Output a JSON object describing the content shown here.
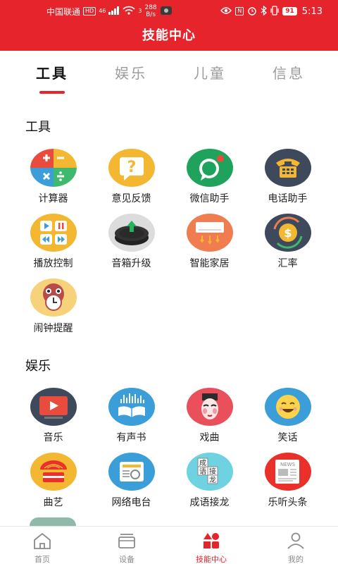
{
  "status_bar": {
    "carrier": "中国联通",
    "hd": "HD",
    "signal": "46",
    "wifi_sub": "3",
    "speed_value": "288",
    "speed_unit": "B/s",
    "nfc": "N",
    "battery": "91",
    "time": "5:13"
  },
  "header": {
    "title": "技能中心"
  },
  "tabs": [
    {
      "label": "工具",
      "active": true
    },
    {
      "label": "娱乐",
      "active": false
    },
    {
      "label": "儿童",
      "active": false
    },
    {
      "label": "信息",
      "active": false
    }
  ],
  "sections": [
    {
      "title": "工具",
      "items": [
        {
          "label": "计算器",
          "icon": "calculator-icon"
        },
        {
          "label": "意见反馈",
          "icon": "question-icon"
        },
        {
          "label": "微信助手",
          "icon": "chat-bubble-icon"
        },
        {
          "label": "电话助手",
          "icon": "telephone-icon"
        },
        {
          "label": "播放控制",
          "icon": "media-controls-icon"
        },
        {
          "label": "音箱升级",
          "icon": "speaker-upgrade-icon"
        },
        {
          "label": "智能家居",
          "icon": "air-conditioner-icon"
        },
        {
          "label": "汇率",
          "icon": "currency-exchange-icon"
        },
        {
          "label": "闹钟提醒",
          "icon": "alarm-clock-icon"
        }
      ]
    },
    {
      "title": "娱乐",
      "items": [
        {
          "label": "音乐",
          "icon": "music-video-icon"
        },
        {
          "label": "有声书",
          "icon": "audiobook-icon"
        },
        {
          "label": "戏曲",
          "icon": "opera-mask-icon"
        },
        {
          "label": "笑话",
          "icon": "smiley-icon"
        },
        {
          "label": "曲艺",
          "icon": "drum-icon"
        },
        {
          "label": "网络电台",
          "icon": "radio-icon"
        },
        {
          "label": "成语接龙",
          "icon": "idiom-puzzle-icon",
          "chars": [
            "成",
            "语",
            "接",
            "龙"
          ]
        },
        {
          "label": "乐听头条",
          "icon": "newspaper-icon",
          "news": "NEWS"
        }
      ]
    }
  ],
  "bottom_nav": [
    {
      "label": "首页",
      "icon": "home-icon",
      "active": false
    },
    {
      "label": "设备",
      "icon": "device-icon",
      "active": false
    },
    {
      "label": "技能中心",
      "icon": "skills-icon",
      "active": true
    },
    {
      "label": "我的",
      "icon": "profile-icon",
      "active": false
    }
  ],
  "colors": {
    "accent": "#e5242b"
  }
}
